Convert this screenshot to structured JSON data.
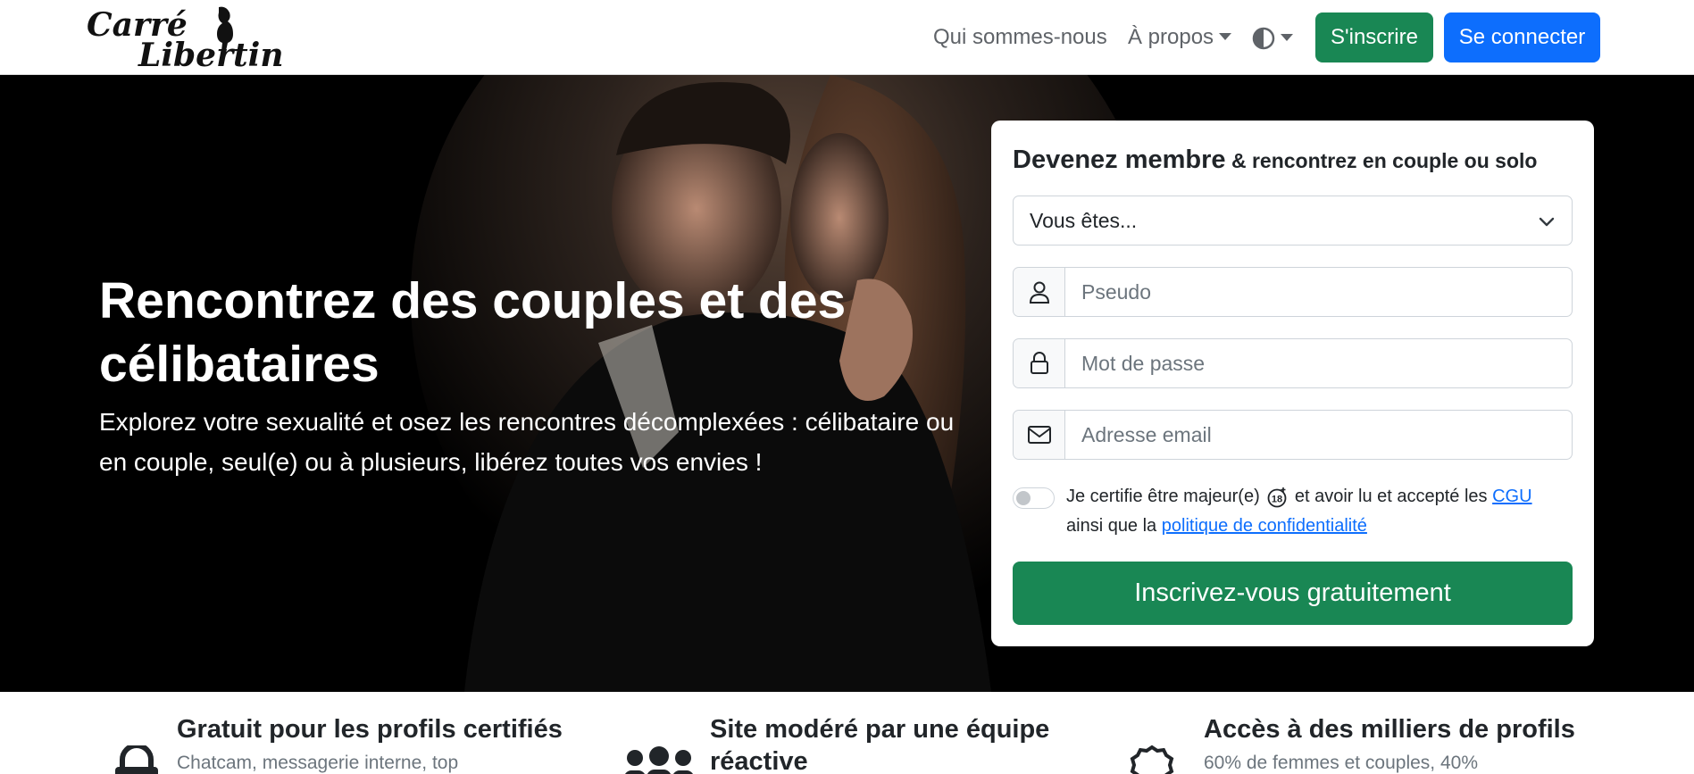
{
  "navbar": {
    "logo_text_line1": "Carré",
    "logo_text_line2": "Libertin",
    "links": {
      "qui": "Qui sommes-nous",
      "about": "À propos"
    },
    "theme_icon": "contrast-icon",
    "signup_label": "S'inscrire",
    "login_label": "Se connecter"
  },
  "hero": {
    "title": "Rencontrez des couples et des célibataires",
    "subtitle": "Explorez votre sexualité et osez les rencontres décomplexées : célibataire ou en couple, seul(e) ou à plusieurs, libérez toutes vos envies !"
  },
  "form": {
    "title_main": "Devenez membre",
    "title_rest": " & rencontrez en couple ou solo",
    "select_value": "Vous êtes...",
    "pseudo_placeholder": "Pseudo",
    "password_placeholder": "Mot de passe",
    "email_placeholder": "Adresse email",
    "consent_part1": "Je certifie être majeur(e)",
    "consent_part2": " et avoir lu et accepté les ",
    "cgu_link": "CGU",
    "consent_part3": " ainsi que la ",
    "privacy_link": "politique de confidentialité",
    "submit_label": "Inscrivez-vous gratuitement"
  },
  "features": [
    {
      "title": "Gratuit pour les profils certifiés",
      "desc": "Chatcam, messagerie interne, top",
      "icon": "lock-icon"
    },
    {
      "title_line1": "Site modéré par une équipe",
      "title_line2": "réactive",
      "icon": "team-icon"
    },
    {
      "title": "Accès à des milliers de profils",
      "desc": "60% de femmes et couples, 40%",
      "icon": "badge-check-icon"
    }
  ],
  "colors": {
    "primary": "#0d6efd",
    "success": "#198754",
    "nav_text": "#5f6368",
    "hero_bg": "#000000"
  }
}
